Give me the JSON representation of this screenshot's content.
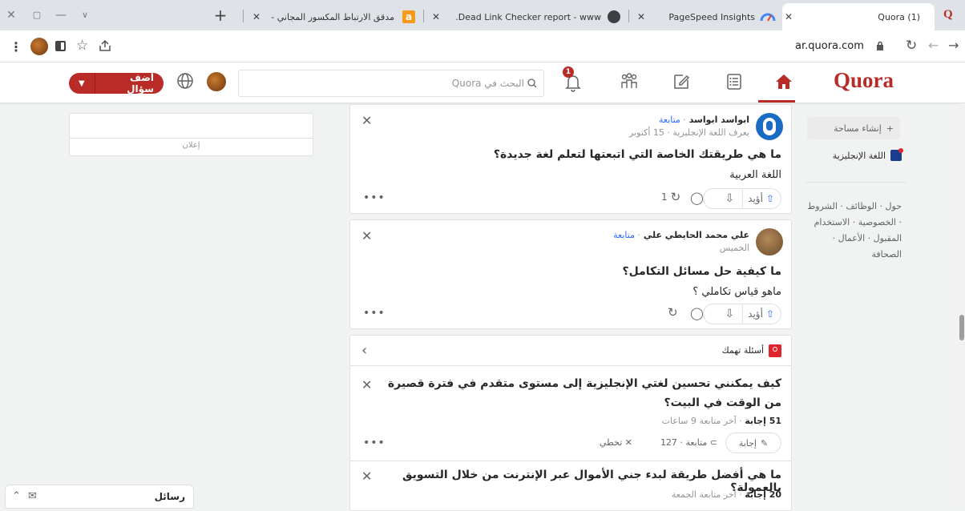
{
  "browser": {
    "tabs": [
      {
        "title": "(1) Quora",
        "active": true
      },
      {
        "title": "PageSpeed Insights"
      },
      {
        "title": "Dead Link Checker report - www."
      },
      {
        "title": "مدقق الارتباط المكسور المجاني - أ"
      }
    ],
    "new_tab": "+",
    "url": "ar.quora.com",
    "colors": {
      "titlebar": "#dfe3e8",
      "pagespeed": "#4285f4",
      "amazon_a": "#f89b1c"
    }
  },
  "header": {
    "logo": "Quora",
    "search_placeholder": "البحث في Quora",
    "notification_count": "1",
    "add_question_label": "أضف سؤال",
    "colors": {
      "brand": "#b92b27",
      "accent": "#2e69ff"
    }
  },
  "left_sidebar": {
    "create_space": "إنشاء مساحة",
    "space_name": "اللغة الإنجليزية",
    "footer_links": "حول · الوظائف · الشروط · الخصوصية · الاستخدام المقبول · الأعمال · الصحافة"
  },
  "ad": {
    "label": "إعلان"
  },
  "feed": {
    "posts": [
      {
        "author": "ابواسد ابواسد",
        "follow": "متابعة",
        "meta": "يعرف اللغة الإنجليزية · 15 أكتوبر",
        "question": "ما هي طريقتك الخاصة التي اتبعتها لتعلم لغة جديدة؟",
        "body": "اللغة العربية",
        "upvote_label": "أؤيد",
        "share_count": "1"
      },
      {
        "author": "علي محمد الحايطي علي",
        "follow": "متابعة",
        "meta": "الخميس",
        "question": "ما كيفية حل مسائل التكامل؟",
        "body": "ماهو قياس تكاملي ؟",
        "upvote_label": "أؤيد",
        "share_count": ""
      }
    ],
    "related": {
      "title": "أسئلة تهمك",
      "questions": [
        {
          "text": "كيف يمكنني تحسين لغتي الإنجليزية إلى مستوى متقدم في فترة قصيرة من الوقت في البيت؟",
          "answers": "51 إجابة",
          "activity": "آخر متابعة 9 ساعات",
          "answer_btn": "إجابة",
          "follow_btn": "متابعة",
          "follow_count": "127",
          "pass_btn": "تخطي"
        },
        {
          "text": "ما هي أفضل طريقة لبدء جني الأموال عبر الإنترنت من خلال التسويق بالعمولة؟",
          "answers": "20 إجابة",
          "activity": "آخر متابعة الجمعة"
        }
      ]
    }
  },
  "messages": {
    "label": "رسائل"
  }
}
